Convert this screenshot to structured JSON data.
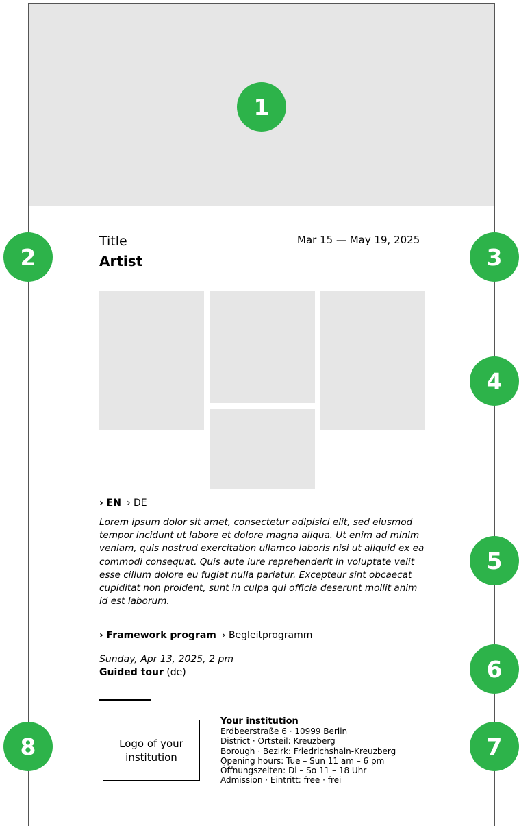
{
  "markers": [
    "1",
    "2",
    "3",
    "4",
    "5",
    "6",
    "7",
    "8"
  ],
  "header": {
    "title": "Title",
    "artist": "Artist",
    "dates": "Mar 15 — May 19, 2025"
  },
  "language": {
    "active": "› EN",
    "other": "› DE"
  },
  "body_text": "Lorem ipsum dolor sit amet, consectetur adipisici elit, sed eiusmod tempor incidunt ut labore et dolore magna aliqua. Ut enim ad minim veniam, quis nostrud exercitation ullamco laboris nisi ut aliquid ex ea commodi consequat. Quis aute iure reprehenderit in voluptate velit esse cillum dolore eu fugiat nulla pariatur. Excepteur sint obcaecat cupiditat non proident, sunt in culpa qui officia deserunt mollit anim id est laborum.",
  "program": {
    "active": "› Framework program",
    "other": "› Begleitprogramm"
  },
  "event": {
    "date": "Sunday, Apr 13, 2025, 2 pm",
    "title": "Guided tour",
    "lang": "(de)"
  },
  "logo": {
    "label": "Logo of your institution"
  },
  "institution": {
    "name": "Your institution",
    "address": "Erdbeerstraße 6 · 10999 Berlin",
    "district": "District · Ortsteil: Kreuzberg",
    "borough": "Borough · Bezirk: Friedrichshain-Kreuzberg",
    "hours_en": "Opening hours: Tue – Sun 11 am – 6 pm",
    "hours_de": "Öffnungszeiten: Di – So 11 – 18 Uhr",
    "admission": "Admission · Eintritt: free · frei"
  },
  "colors": {
    "marker": "#2db34a",
    "placeholder": "#e6e6e6",
    "frame": "#555555"
  }
}
